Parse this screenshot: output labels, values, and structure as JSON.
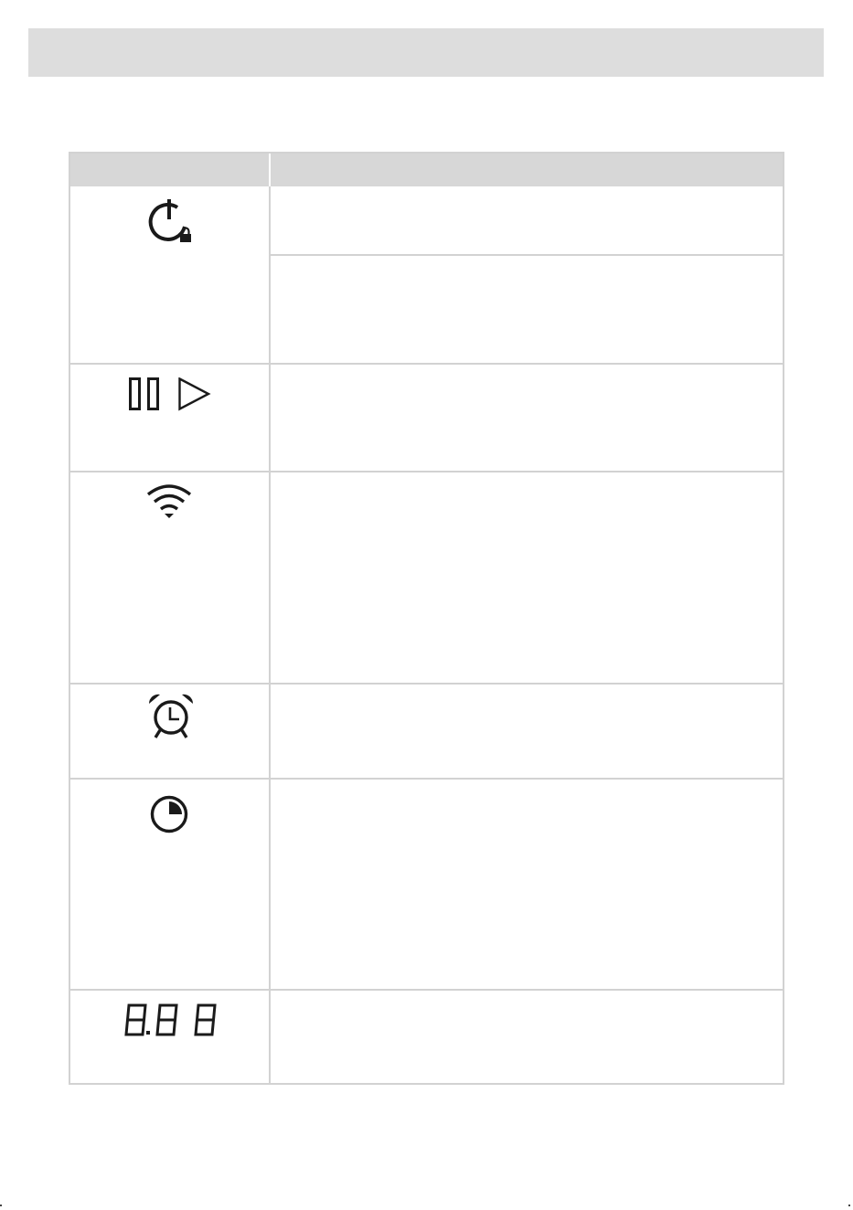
{
  "header": {
    "title": ""
  },
  "table": {
    "columns": [
      "",
      ""
    ],
    "rows": [
      {
        "icon": "power-lock-icon",
        "description": ""
      },
      {
        "icon": "power-lock-icon",
        "description": ""
      },
      {
        "icon": "pause-play-icon",
        "description": ""
      },
      {
        "icon": "wifi-icon",
        "description": ""
      },
      {
        "icon": "alarm-clock-icon",
        "description": ""
      },
      {
        "icon": "timer-icon",
        "description": ""
      },
      {
        "icon": "seven-segment-display-icon",
        "description": ""
      }
    ]
  },
  "colors": {
    "header_band": "#dddddd",
    "table_header": "#d7d7d7",
    "grid": "#d2d2d2",
    "icon": "#1a1a1a"
  }
}
